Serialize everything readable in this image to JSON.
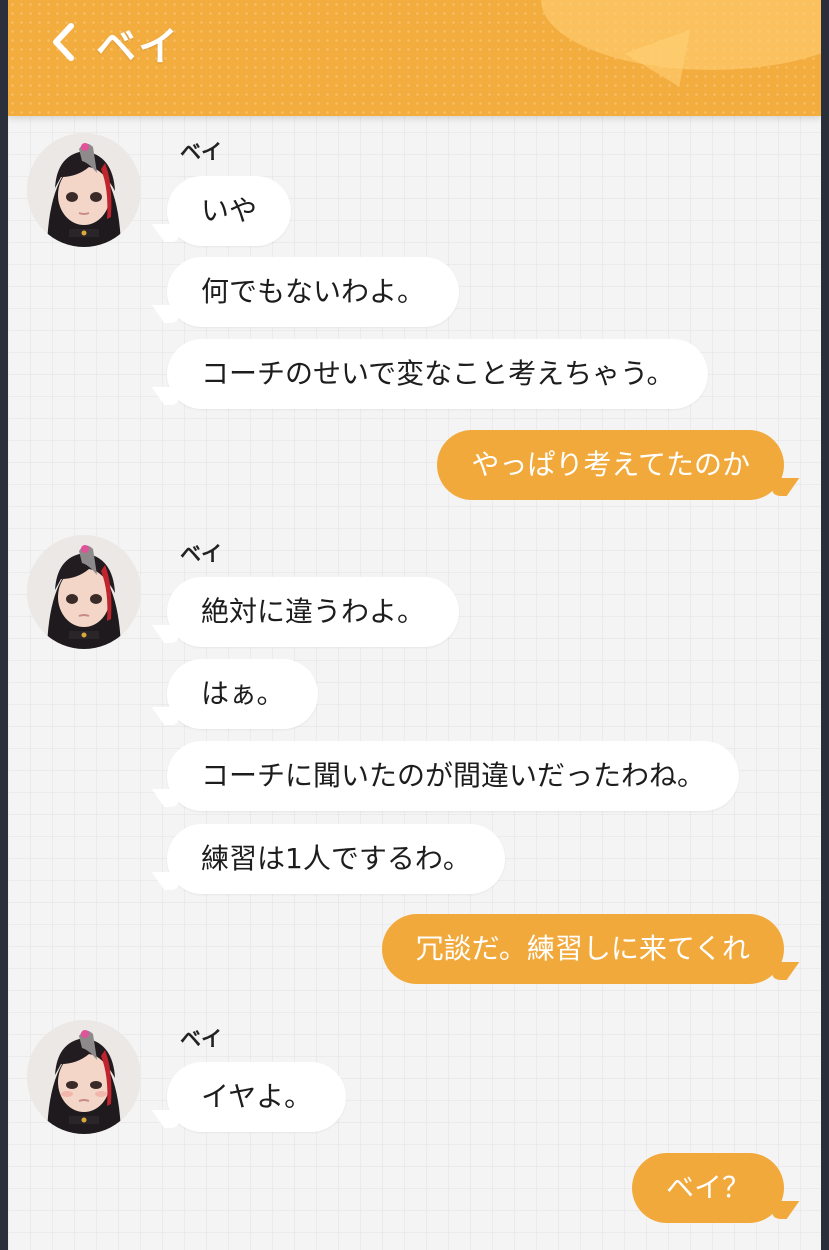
{
  "header": {
    "title": "ベイ",
    "back_icon": "chevron-left-icon",
    "color": "#f3ad3f"
  },
  "colors": {
    "outgoing_bubble": "#f2a93b",
    "incoming_bubble": "#ffffff",
    "background": "#f4f4f4"
  },
  "messages": {
    "group1": {
      "sender": "ベイ",
      "lines": [
        "いや",
        "何でもないわよ。",
        "コーチのせいで変なこと考えちゃう。"
      ]
    },
    "reply1": "やっぱり考えてたのか",
    "group2": {
      "sender": "ベイ",
      "lines": [
        "絶対に違うわよ。",
        "はぁ。",
        "コーチに聞いたのが間違いだったわね。",
        "練習は1人でするわ。"
      ]
    },
    "reply2": "冗談だ。練習しに来てくれ",
    "group3": {
      "sender": "ベイ",
      "lines": [
        "イヤよ。"
      ]
    },
    "reply3": "ベイ？"
  }
}
